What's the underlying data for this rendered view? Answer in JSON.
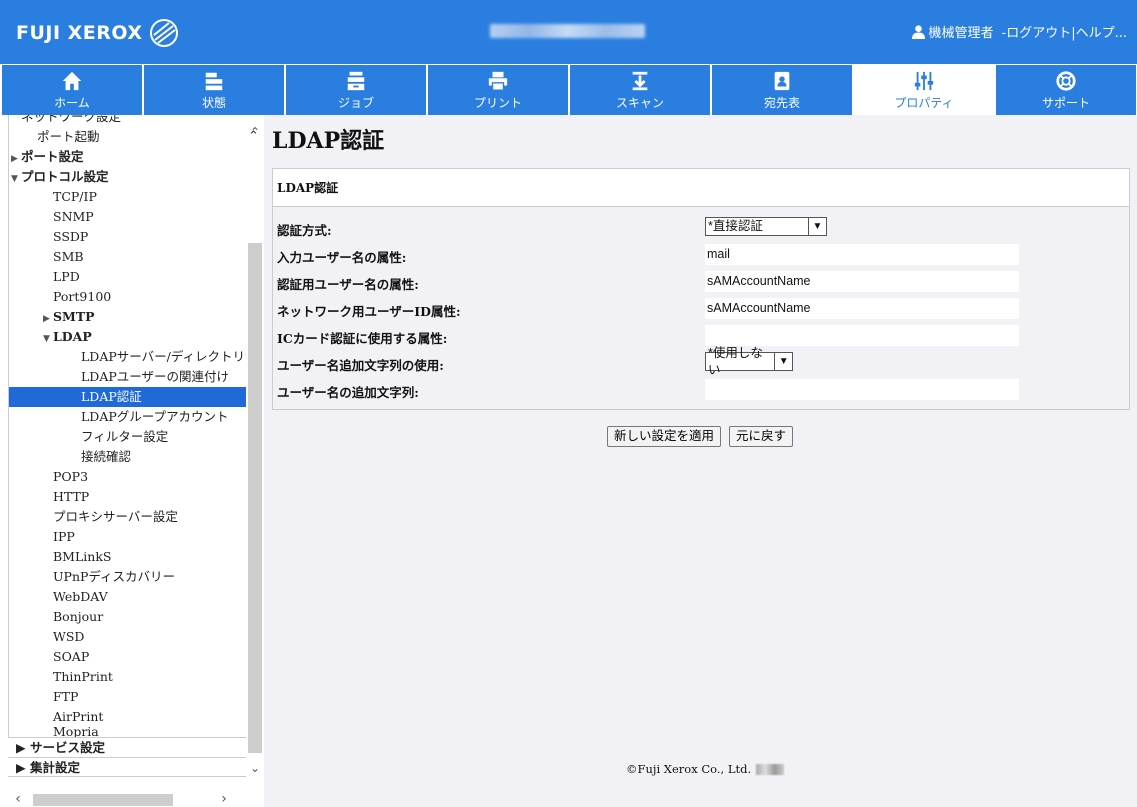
{
  "header": {
    "logo": "FUJI XEROX",
    "user_label": "機械管理者",
    "logout": "-ログアウト|",
    "help": "ヘルプ..."
  },
  "tabs": [
    {
      "label": "ホーム",
      "icon": "home-icon"
    },
    {
      "label": "状態",
      "icon": "printer-status-icon"
    },
    {
      "label": "ジョブ",
      "icon": "job-tray-icon"
    },
    {
      "label": "プリント",
      "icon": "print-icon"
    },
    {
      "label": "スキャン",
      "icon": "scan-icon"
    },
    {
      "label": "宛先表",
      "icon": "address-book-icon"
    },
    {
      "label": "プロパティ",
      "icon": "sliders-icon",
      "active": true
    },
    {
      "label": "サポート",
      "icon": "lifebuoy-icon"
    }
  ],
  "sidebar": {
    "items": [
      {
        "label": "ネットワーク設定",
        "indent": 1,
        "arrow": ""
      },
      {
        "label": "ポート起動",
        "indent": 2,
        "arrow": ""
      },
      {
        "label": "ポート設定",
        "indent": 1,
        "arrow": "▶",
        "bold": true
      },
      {
        "label": "プロトコル設定",
        "indent": 1,
        "arrow": "▼",
        "bold": true
      },
      {
        "label": "TCP/IP",
        "indent": 3,
        "arrow": ""
      },
      {
        "label": "SNMP",
        "indent": 3,
        "arrow": ""
      },
      {
        "label": "SSDP",
        "indent": 3,
        "arrow": ""
      },
      {
        "label": "SMB",
        "indent": 3,
        "arrow": ""
      },
      {
        "label": "LPD",
        "indent": 3,
        "arrow": ""
      },
      {
        "label": "Port9100",
        "indent": 3,
        "arrow": ""
      },
      {
        "label": "SMTP",
        "indent": 3,
        "arrow": "▶",
        "bold": true
      },
      {
        "label": "LDAP",
        "indent": 3,
        "arrow": "▼",
        "bold": true
      },
      {
        "label": "LDAPサーバー/ディレクトリサービス",
        "indent": 4,
        "arrow": ""
      },
      {
        "label": "LDAPユーザーの関連付け",
        "indent": 4,
        "arrow": ""
      },
      {
        "label": "LDAP認証",
        "indent": 4,
        "arrow": "",
        "selected": true
      },
      {
        "label": "LDAPグループアカウント",
        "indent": 4,
        "arrow": ""
      },
      {
        "label": "フィルター設定",
        "indent": 4,
        "arrow": ""
      },
      {
        "label": "接続確認",
        "indent": 4,
        "arrow": ""
      },
      {
        "label": "POP3",
        "indent": 3,
        "arrow": ""
      },
      {
        "label": "HTTP",
        "indent": 3,
        "arrow": ""
      },
      {
        "label": "プロキシサーバー設定",
        "indent": 3,
        "arrow": ""
      },
      {
        "label": "IPP",
        "indent": 3,
        "arrow": ""
      },
      {
        "label": "BMLinkS",
        "indent": 3,
        "arrow": ""
      },
      {
        "label": "UPnPディスカバリー",
        "indent": 3,
        "arrow": ""
      },
      {
        "label": "WebDAV",
        "indent": 3,
        "arrow": ""
      },
      {
        "label": "Bonjour",
        "indent": 3,
        "arrow": ""
      },
      {
        "label": "WSD",
        "indent": 3,
        "arrow": ""
      },
      {
        "label": "SOAP",
        "indent": 3,
        "arrow": ""
      },
      {
        "label": "ThinPrint",
        "indent": 3,
        "arrow": ""
      },
      {
        "label": "FTP",
        "indent": 3,
        "arrow": ""
      },
      {
        "label": "AirPrint",
        "indent": 3,
        "arrow": ""
      },
      {
        "label": "Mopria",
        "indent": 3,
        "arrow": ""
      }
    ],
    "bottom": [
      {
        "label": "▶ サービス設定"
      },
      {
        "label": "▶ 集計設定"
      }
    ]
  },
  "main": {
    "title": "LDAP認証",
    "panel_title": "LDAP認証",
    "fields": [
      {
        "label": "認証方式:",
        "type": "select",
        "value": "*直接認証"
      },
      {
        "label": "入力ユーザー名の属性:",
        "type": "text",
        "value": "mail"
      },
      {
        "label": "認証用ユーザー名の属性:",
        "type": "text",
        "value": "sAMAccountName"
      },
      {
        "label": "ネットワーク用ユーザーID属性:",
        "type": "text",
        "value": "sAMAccountName"
      },
      {
        "label": "ICカード認証に使用する属性:",
        "type": "text",
        "value": ""
      },
      {
        "label": "ユーザー名追加文字列の使用:",
        "type": "select",
        "value": "*使用しない"
      },
      {
        "label": "ユーザー名の追加文字列:",
        "type": "text",
        "value": ""
      }
    ],
    "apply_button": "新しい設定を適用",
    "undo_button": "元に戻す",
    "footer": "©Fuji Xerox Co., Ltd."
  }
}
